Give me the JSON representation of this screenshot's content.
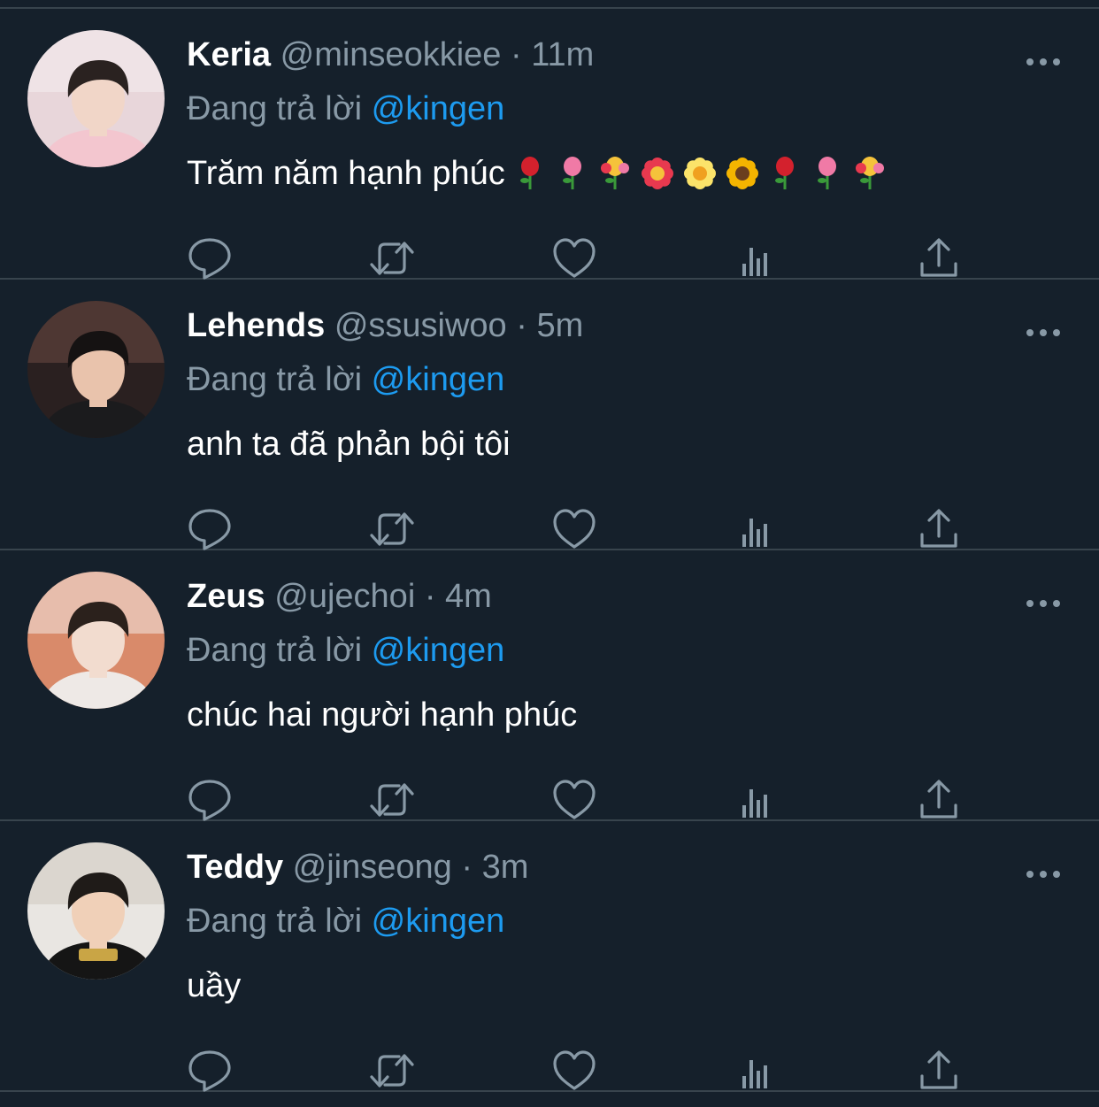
{
  "reply_prefix": "Đang trả lời",
  "colors": {
    "background": "#15202b",
    "secondary_text": "#8899a6",
    "link": "#1d9bf0",
    "divider": "#38444d"
  },
  "tweets": [
    {
      "name": "Keria",
      "handle": "@minseokkiee",
      "separator": "·",
      "time": "11m",
      "reply_to": "@kingen",
      "text": "Trăm năm hạnh phúc",
      "emojis": [
        "rose",
        "tulip",
        "bouquet",
        "hibiscus",
        "blossom",
        "sunflower",
        "rose",
        "tulip",
        "bouquet"
      ]
    },
    {
      "name": "Lehends",
      "handle": "@ssusiwoo",
      "separator": "·",
      "time": "5m",
      "reply_to": "@kingen",
      "text": "anh ta đã phản bội tôi",
      "emojis": []
    },
    {
      "name": "Zeus",
      "handle": "@ujechoi",
      "separator": "·",
      "time": "4m",
      "reply_to": "@kingen",
      "text": "chúc hai người hạnh phúc",
      "emojis": []
    },
    {
      "name": "Teddy",
      "handle": "@jinseong",
      "separator": "·",
      "time": "3m",
      "reply_to": "@kingen",
      "text": "uầy",
      "emojis": []
    }
  ],
  "action_icons": [
    "reply-icon",
    "retweet-icon",
    "like-icon",
    "views-icon",
    "share-icon"
  ]
}
